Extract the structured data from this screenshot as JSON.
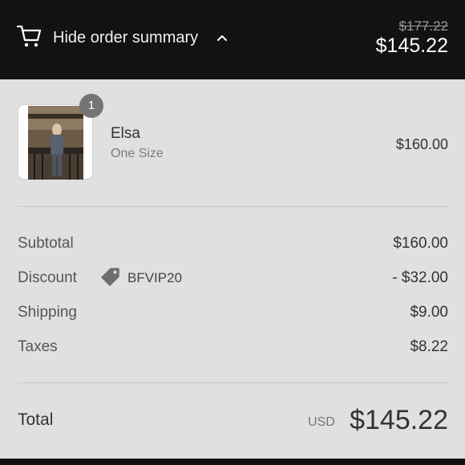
{
  "header": {
    "toggle_label": "Hide order summary",
    "old_total": "$177.22",
    "total": "$145.22"
  },
  "item": {
    "quantity": "1",
    "name": "Elsa",
    "variant": "One Size",
    "price": "$160.00"
  },
  "summary": {
    "subtotal_label": "Subtotal",
    "subtotal_value": "$160.00",
    "discount_label": "Discount",
    "discount_code": "BFVIP20",
    "discount_value": "- $32.00",
    "shipping_label": "Shipping",
    "shipping_value": "$9.00",
    "taxes_label": "Taxes",
    "taxes_value": "$8.22"
  },
  "total": {
    "label": "Total",
    "currency": "USD",
    "value": "$145.22"
  },
  "icons": {
    "cart": "cart-icon",
    "chevron": "chevron-up-icon",
    "tag": "tag-icon"
  },
  "colors": {
    "header_bg": "#121212",
    "summary_bg": "#e0e0e0",
    "badge_bg": "#747474"
  }
}
